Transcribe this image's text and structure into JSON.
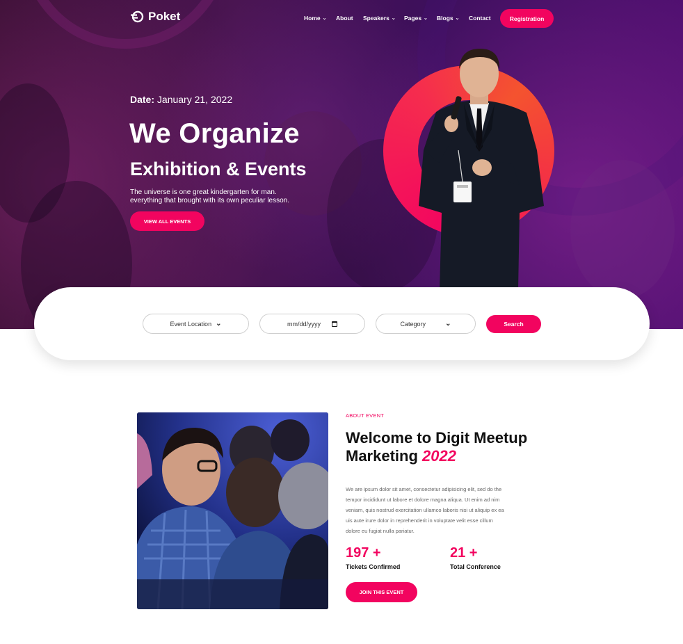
{
  "brand": {
    "name": "Poket",
    "accent": "#f2045f"
  },
  "nav": {
    "items": [
      {
        "label": "Home",
        "dropdown": true
      },
      {
        "label": "About",
        "dropdown": false
      },
      {
        "label": "Speakers",
        "dropdown": true
      },
      {
        "label": "Pages",
        "dropdown": true
      },
      {
        "label": "Blogs",
        "dropdown": true
      },
      {
        "label": "Contact",
        "dropdown": false
      }
    ],
    "cta": "Registration"
  },
  "hero": {
    "date_label": "Date:",
    "date_value": "January 21, 2022",
    "title": "We Organize",
    "subtitle": "Exhibition & Events",
    "desc_line1": "The universe is one great kindergarten for man.",
    "desc_line2": "everything that brought with its own peculiar lesson.",
    "button": "VIEW ALL EVENTS"
  },
  "search": {
    "location": "Event Location",
    "date_placeholder": "mm/dd/yyyy",
    "category": "Category",
    "button": "Search"
  },
  "about": {
    "kicker": "ABOUT EVENT",
    "title_line1": "Welcome to Digit Meetup",
    "title_line2": "Marketing",
    "title_year": "2022",
    "body_lines": [
      "We are ipsum dolor sit amet, consectetur adipisicing elit, sed do the",
      "tempor incididunt ut labore et dolore magna aliqua. Ut enim ad nim",
      "veniam, quis nostrud exercitation ullamco laboris nisi ut aliquip ex ea",
      "uis aute irure dolor in reprehenderit in voluptate velit esse cillum",
      "dolore eu fugiat nulla pariatur."
    ],
    "stats": [
      {
        "value": "197 +",
        "label": "Tickets Confirmed"
      },
      {
        "value": "21 +",
        "label": "Total Conference"
      }
    ],
    "button": "JOIN THIS EVENT"
  }
}
